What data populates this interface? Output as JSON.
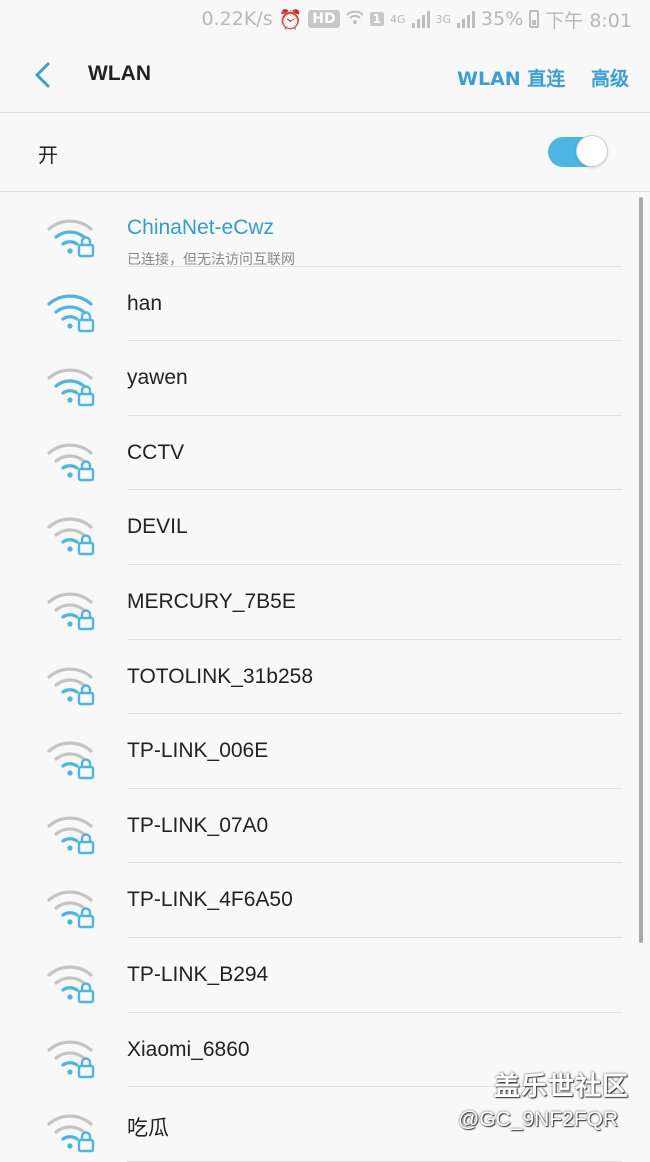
{
  "status_bar": {
    "speed": "0.22K/s",
    "hd": "HD",
    "sim": "1",
    "net1": "4G",
    "net2": "3G",
    "battery": "35%",
    "time": "下午 8:01"
  },
  "header": {
    "title": "WLAN",
    "direct_label": "WLAN 直连",
    "advanced_label": "高级"
  },
  "toggle": {
    "label": "开",
    "on": true
  },
  "networks": [
    {
      "name": "ChinaNet-eCwz",
      "status": "已连接，但无法访问互联网",
      "signal": 3,
      "locked": true,
      "connected": true
    },
    {
      "name": "han",
      "signal": 4,
      "locked": true
    },
    {
      "name": "yawen",
      "signal": 3,
      "locked": true
    },
    {
      "name": "CCTV",
      "signal": 2,
      "locked": true
    },
    {
      "name": "DEVIL",
      "signal": 2,
      "locked": true
    },
    {
      "name": "MERCURY_7B5E",
      "signal": 2,
      "locked": true
    },
    {
      "name": "TOTOLINK_31b258",
      "signal": 2,
      "locked": true
    },
    {
      "name": "TP-LINK_006E",
      "signal": 2,
      "locked": true
    },
    {
      "name": "TP-LINK_07A0",
      "signal": 2,
      "locked": true
    },
    {
      "name": "TP-LINK_4F6A50",
      "signal": 2,
      "locked": true
    },
    {
      "name": "TP-LINK_B294",
      "signal": 2,
      "locked": true
    },
    {
      "name": "Xiaomi_6860",
      "signal": 2,
      "locked": true
    },
    {
      "name": "吃瓜",
      "signal": 2,
      "locked": true
    }
  ],
  "colors": {
    "accent": "#3a9fd6",
    "wifi_active": "#4db5e3",
    "wifi_inactive": "#c4c4c4"
  },
  "watermark": {
    "line1": "盖乐世社区",
    "line2": "@GC_9NF2FQR"
  }
}
